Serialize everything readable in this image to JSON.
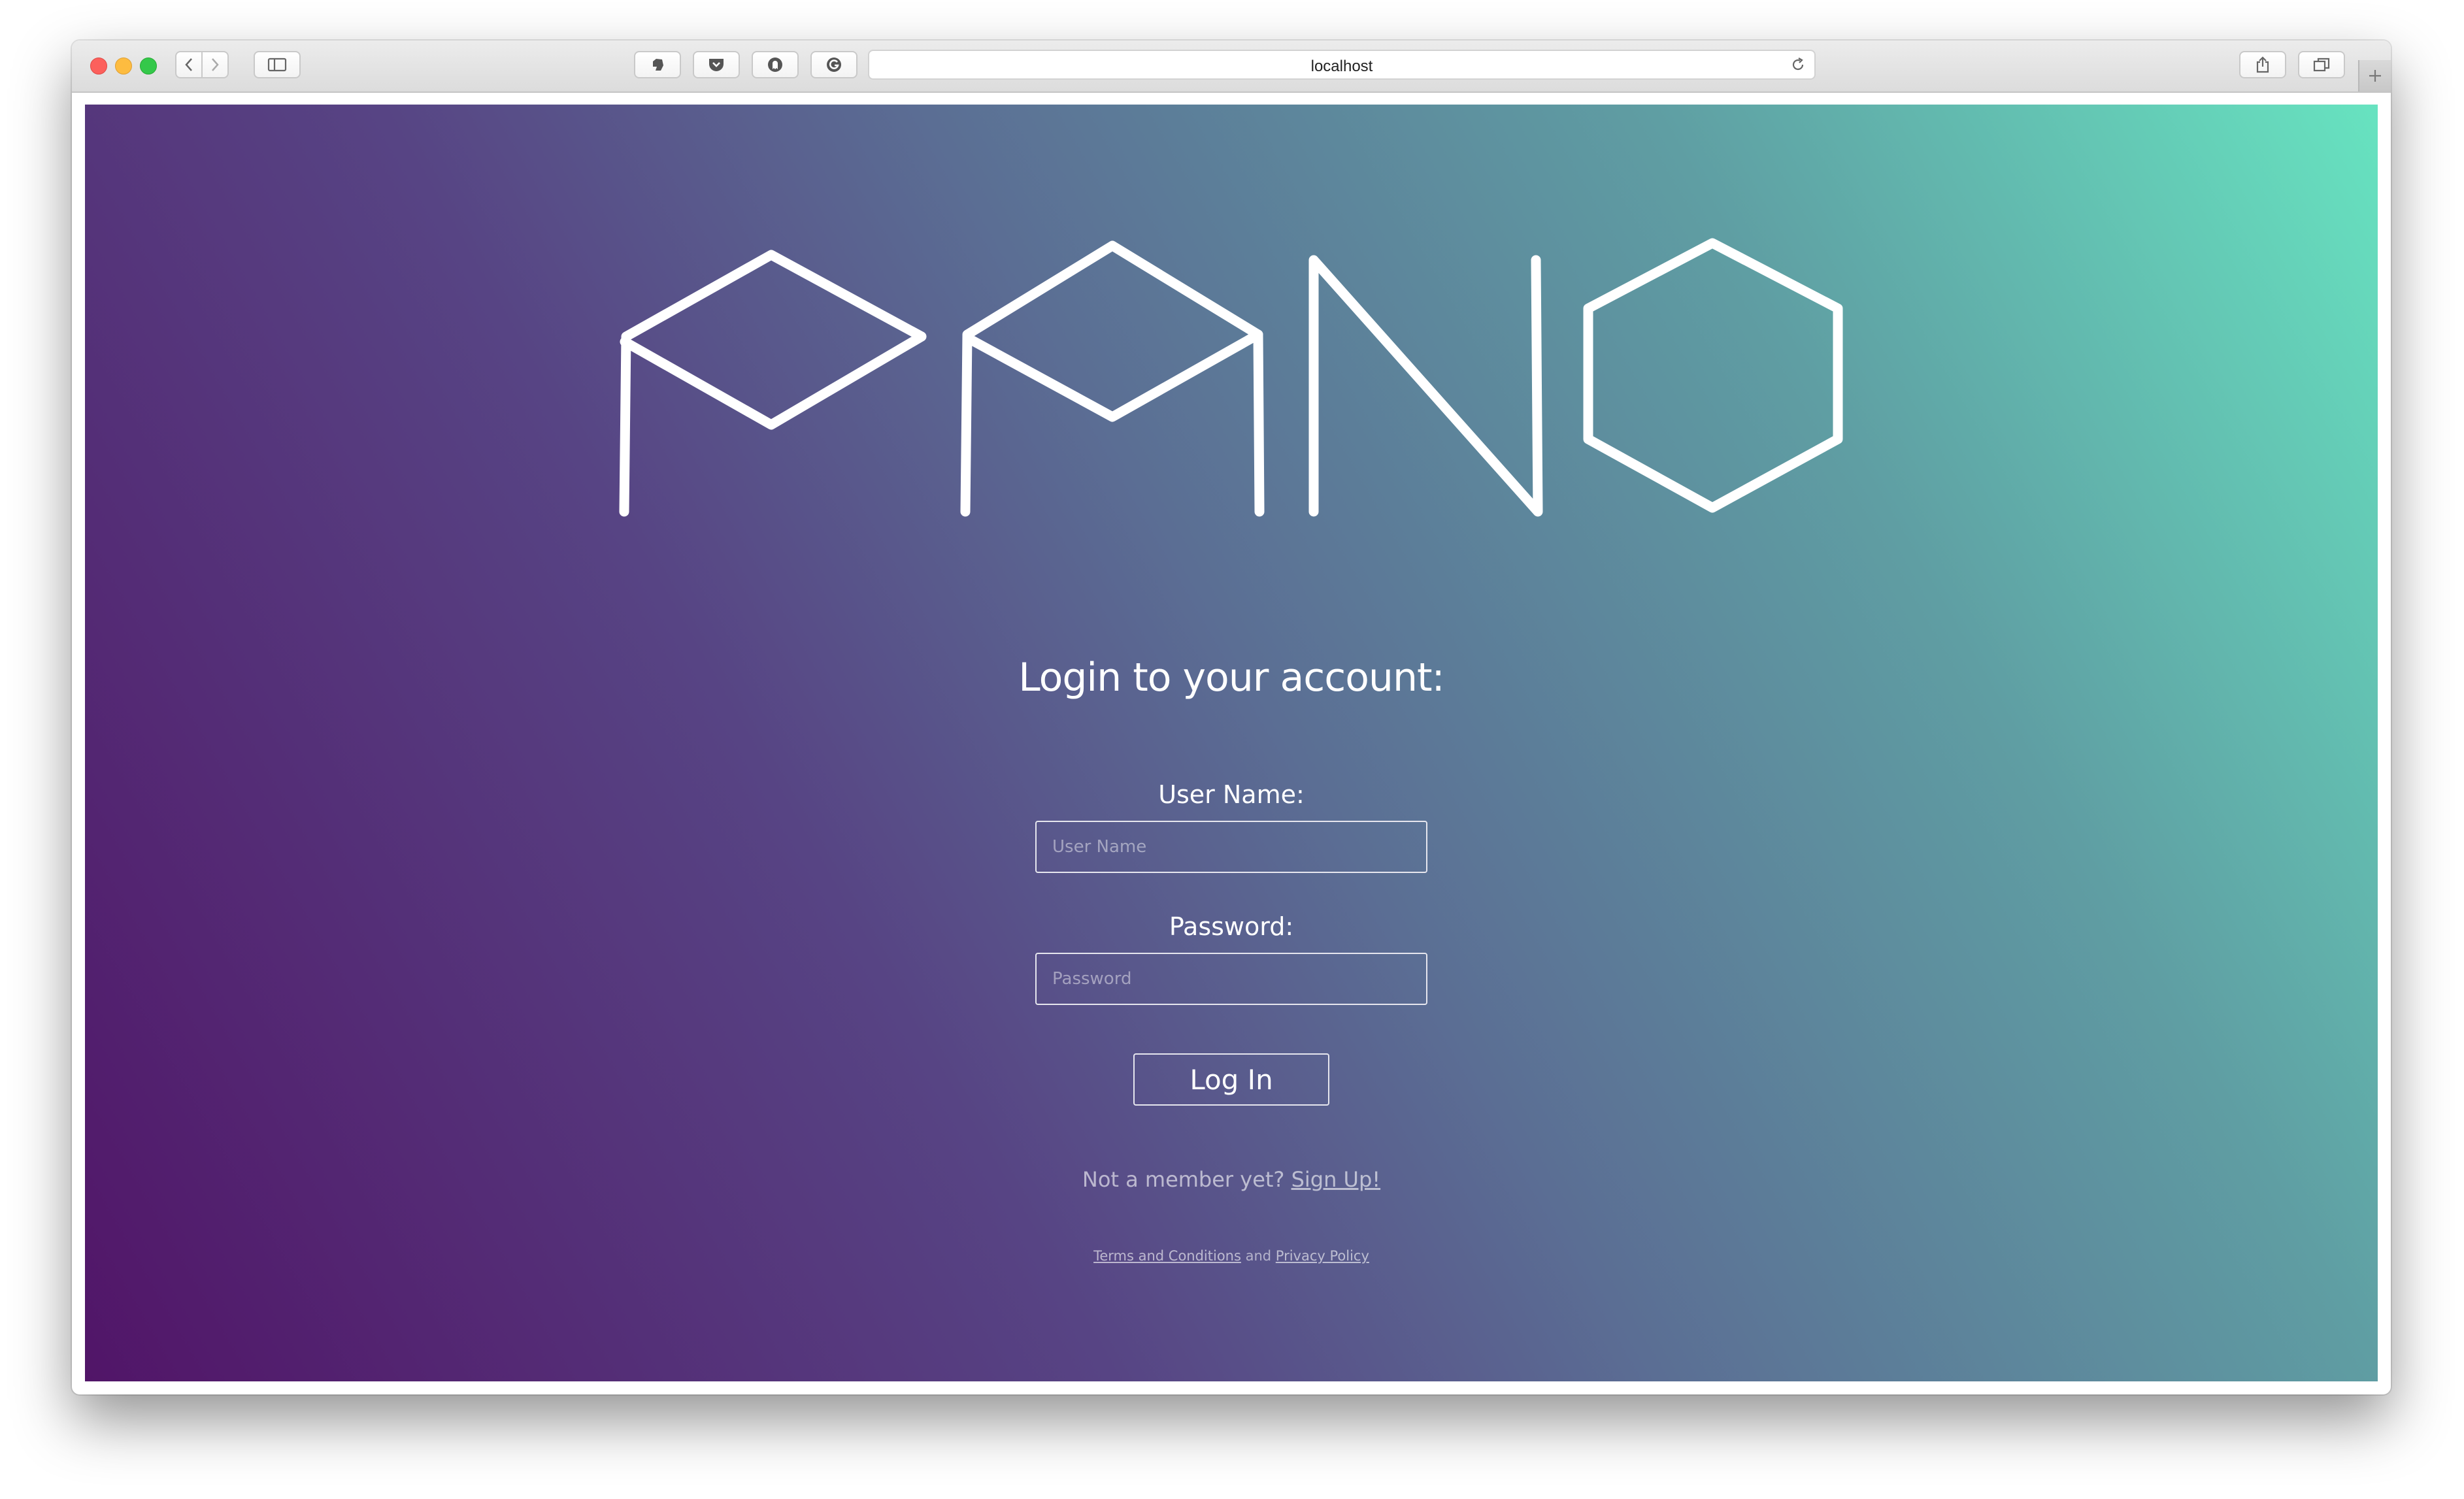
{
  "browser": {
    "address": "localhost"
  },
  "logo": {
    "text": "PANO"
  },
  "login": {
    "heading": "Login to your account:",
    "username_label": "User Name:",
    "username_placeholder": "User Name",
    "username_value": "",
    "password_label": "Password:",
    "password_placeholder": "Password",
    "password_value": "",
    "submit_label": "Log In",
    "signup_prompt": "Not a member yet? ",
    "signup_link": "Sign Up!",
    "terms_link": "Terms and Conditions",
    "legal_and": " and ",
    "privacy_link": "Privacy Policy"
  },
  "colors": {
    "gradient_start": "#511568",
    "gradient_end": "#67e3c0",
    "logo_stroke": "#ffffff"
  }
}
